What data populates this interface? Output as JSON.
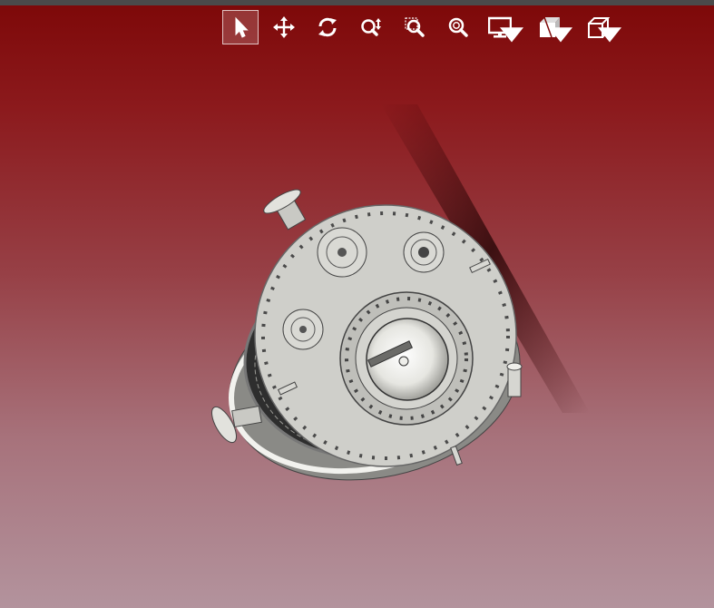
{
  "toolbar": {
    "tools": [
      {
        "icon": "select-arrow-icon",
        "active": true
      },
      {
        "icon": "pan-move-icon",
        "active": false
      },
      {
        "icon": "rotate-icon",
        "active": false
      },
      {
        "icon": "zoom-updown-icon",
        "active": false
      },
      {
        "icon": "zoom-window-icon",
        "active": false
      },
      {
        "icon": "zoom-fit-icon",
        "active": false
      },
      {
        "icon": "display-monitor-icon",
        "dropdown": true
      },
      {
        "icon": "section-view-icon",
        "dropdown": true
      },
      {
        "icon": "view-cube-icon",
        "dropdown": true
      }
    ]
  },
  "colors": {
    "background_top": "#7d0808",
    "background_bottom": "#b3939d",
    "model_face": "#cfcfca",
    "icon": "#ffffff"
  }
}
